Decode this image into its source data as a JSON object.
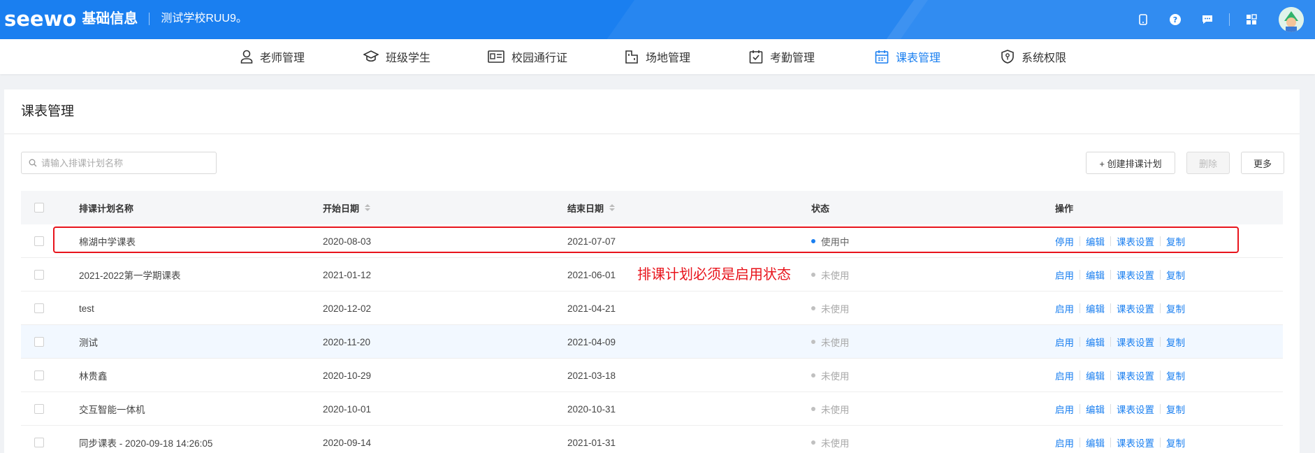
{
  "header": {
    "logo": "seewo",
    "app_name": "基础信息",
    "school": "测试学校RUU9",
    "school_suffix": "。",
    "icons": [
      "phone-icon",
      "help-icon",
      "message-icon",
      "apps-icon",
      "avatar"
    ]
  },
  "nav": {
    "items": [
      {
        "label": "老师管理",
        "icon": "person-icon"
      },
      {
        "label": "班级学生",
        "icon": "graduation-cap-icon"
      },
      {
        "label": "校园通行证",
        "icon": "id-card-icon"
      },
      {
        "label": "场地管理",
        "icon": "venue-icon"
      },
      {
        "label": "考勤管理",
        "icon": "attendance-icon"
      },
      {
        "label": "课表管理",
        "icon": "calendar-icon",
        "active": true
      },
      {
        "label": "系统权限",
        "icon": "shield-icon"
      }
    ]
  },
  "page": {
    "title": "课表管理",
    "search_placeholder": "请输入排课计划名称",
    "create_label": "+ 创建排课计划",
    "delete_label": "删除",
    "more_label": "更多"
  },
  "table": {
    "headers": {
      "name": "排课计划名称",
      "start": "开始日期",
      "end": "结束日期",
      "status": "状态",
      "actions": "操作"
    },
    "rows": [
      {
        "name": "棉湖中学课表",
        "start": "2020-08-03",
        "end": "2021-07-07",
        "status": "使用中",
        "toggle": "停用",
        "edit": "编辑",
        "settings": "课表设置",
        "copy": "复制"
      },
      {
        "name": "2021-2022第一学期课表",
        "start": "2021-01-12",
        "end": "2021-06-01",
        "status": "未使用",
        "toggle": "启用",
        "edit": "编辑",
        "settings": "课表设置",
        "copy": "复制"
      },
      {
        "name": "test",
        "start": "2020-12-02",
        "end": "2021-04-21",
        "status": "未使用",
        "toggle": "启用",
        "edit": "编辑",
        "settings": "课表设置",
        "copy": "复制"
      },
      {
        "name": "测试",
        "start": "2020-11-20",
        "end": "2021-04-09",
        "status": "未使用",
        "toggle": "启用",
        "edit": "编辑",
        "settings": "课表设置",
        "copy": "复制"
      },
      {
        "name": "林贵鑫",
        "start": "2020-10-29",
        "end": "2021-03-18",
        "status": "未使用",
        "toggle": "启用",
        "edit": "编辑",
        "settings": "课表设置",
        "copy": "复制"
      },
      {
        "name": "交互智能一体机",
        "start": "2020-10-01",
        "end": "2020-10-31",
        "status": "未使用",
        "toggle": "启用",
        "edit": "编辑",
        "settings": "课表设置",
        "copy": "复制"
      },
      {
        "name": "同步课表 - 2020-09-18 14:26:05",
        "start": "2020-09-14",
        "end": "2021-01-31",
        "status": "未使用",
        "toggle": "启用",
        "edit": "编辑",
        "settings": "课表设置",
        "copy": "复制"
      }
    ]
  },
  "annotation": "排课计划必须是启用状态",
  "colors": {
    "brand": "#1a7ff0",
    "annotation": "#e8141c",
    "active_dot": "#1a7ff0",
    "inactive_dot": "#c0c0c0"
  }
}
